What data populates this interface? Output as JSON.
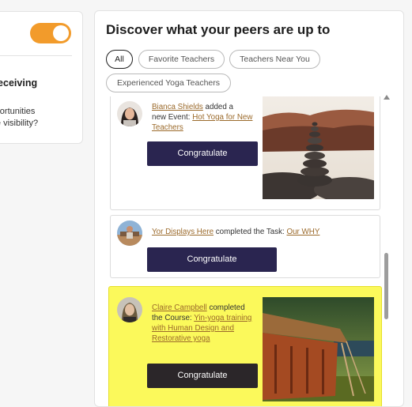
{
  "left_card": {
    "title": "w receiving\ns!",
    "body": "Opportunities\nnore visibility?"
  },
  "panel": {
    "title": "Discover what your peers are up to",
    "filters": [
      "All",
      "Favorite Teachers",
      "Teachers Near You",
      "Experienced Yoga Teachers"
    ],
    "active_filter": "All"
  },
  "feed": [
    {
      "user": "Bianca Shields",
      "action_1": "added a",
      "action_2": "new Event:",
      "target": "Hot Yoga for New Teachers",
      "button": "Congratulate",
      "image": "stacked-stones-photo"
    },
    {
      "user": "Yor Displays Here",
      "action_1": "completed the Task:",
      "target": "Our WHY",
      "button": "Congratulate"
    },
    {
      "user": "Claire Campbell",
      "action_1": "completed",
      "action_2": "the Course:",
      "target": "Yin-yoga training with Human Design and Restorative yoga",
      "button": "Congratulate",
      "image": "wooden-shack-photo",
      "highlighted": true
    }
  ],
  "colors": {
    "toggle": "#f29b2b",
    "button_navy": "#2a2550",
    "button_dark": "#2b2629",
    "highlight": "#fbf95b",
    "link": "#9b6a2b"
  }
}
